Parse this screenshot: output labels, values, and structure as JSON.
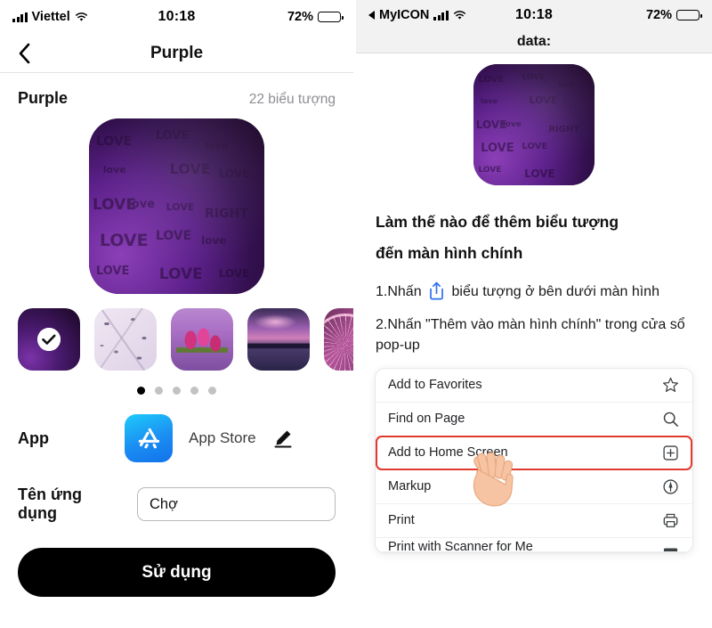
{
  "left_phone": {
    "status_bar": {
      "carrier": "Viettel",
      "time": "10:18",
      "battery_pct": "72%",
      "signal_icon": "cellular-bars-icon",
      "wifi_icon": "wifi-icon",
      "battery_icon": "battery-icon"
    },
    "nav": {
      "back_icon": "chevron-left-icon",
      "title": "Purple"
    },
    "section": {
      "title": "Purple",
      "count": "22 biểu tượng"
    },
    "hero": {
      "icon_name": "rainbow-love-icon"
    },
    "thumbnails": [
      {
        "name": "rainbow-love-thumb",
        "selected": true
      },
      {
        "name": "lavender-botanical-thumb",
        "selected": false
      },
      {
        "name": "purple-tulips-thumb",
        "selected": false
      },
      {
        "name": "purple-skyline-sunset-thumb",
        "selected": false
      },
      {
        "name": "ferris-wheel-thumb",
        "selected": false
      }
    ],
    "pager": {
      "total": 5,
      "active_index": 0
    },
    "app_row": {
      "label": "App",
      "app_icon": "app-store-icon",
      "app_name": "App Store",
      "edit_icon": "pencil-edit-icon"
    },
    "name_row": {
      "label": "Tên ứng dụng",
      "value": "Chợ",
      "placeholder": "Tên ứng dụng"
    },
    "primary_button": {
      "label": "Sử dụng"
    }
  },
  "right_phone": {
    "status_bar": {
      "back_icon": "back-triangle-icon",
      "app_label": "MyICON",
      "time": "10:18",
      "battery_pct": "72%"
    },
    "url_bar": {
      "text": "data:"
    },
    "hero": {
      "icon_name": "rainbow-love-icon"
    },
    "howto": {
      "title_line1": "Làm thế nào để thêm biểu tượng",
      "title_line2": "đến màn hình chính",
      "step1_before": "1.Nhấn",
      "step1_icon": "share-icon",
      "step1_after": "biểu tượng ở bên dưới màn hình",
      "step2": "2.Nhấn \"Thêm vào màn hình chính\" trong cửa sổ pop-up"
    },
    "share_sheet": {
      "rows": [
        {
          "label": "Add to Favorites",
          "icon": "star-icon",
          "highlighted": false
        },
        {
          "label": "Find on Page",
          "icon": "search-icon",
          "highlighted": false
        },
        {
          "label": "Add to Home Screen",
          "icon": "plus-square-icon",
          "highlighted": true
        },
        {
          "label": "Markup",
          "icon": "markup-pen-icon",
          "highlighted": false
        },
        {
          "label": "Print",
          "icon": "printer-icon",
          "highlighted": false
        },
        {
          "label": "Print with Scanner for Me",
          "icon": "scanner-icon",
          "highlighted": false
        }
      ],
      "cursor_icon": "pointing-hand-cursor"
    }
  },
  "colors": {
    "highlight_red": "#e03a2f",
    "share_blue": "#2f6fed",
    "appstore_blue": "#1b8df2",
    "muted_gray": "#8e8e93",
    "hand_skin": "#f6c4a2"
  }
}
